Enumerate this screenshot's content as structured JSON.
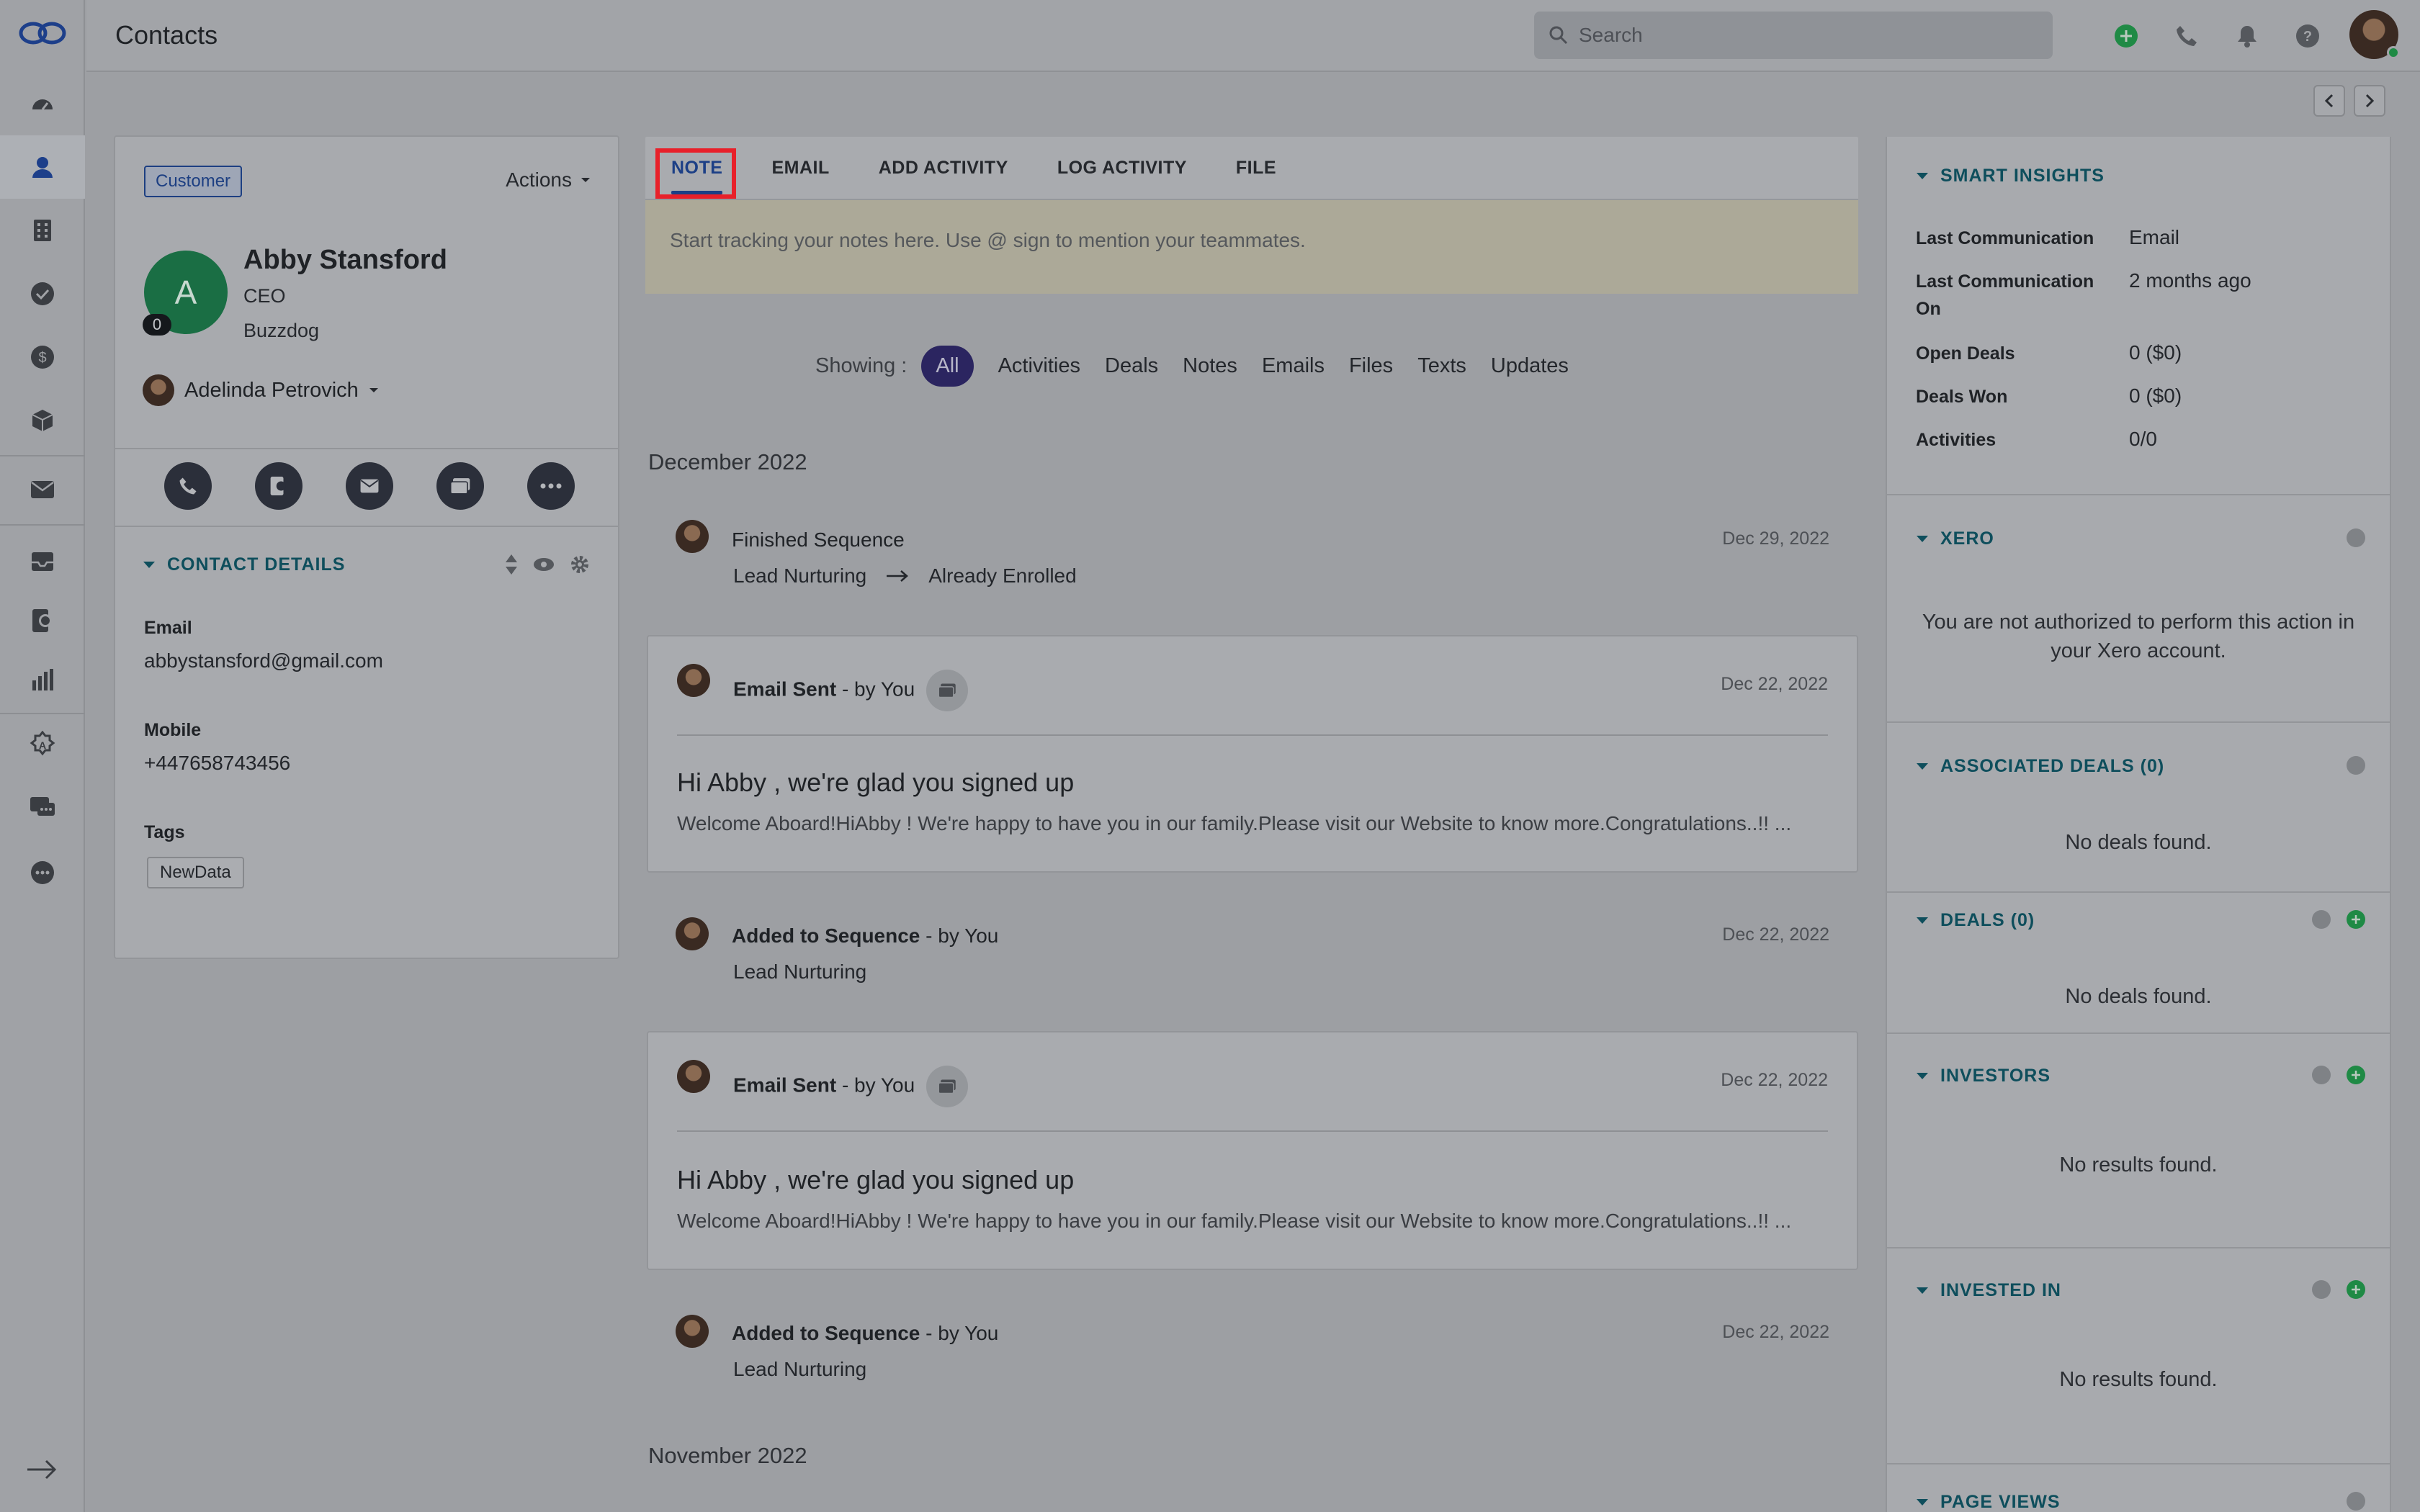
{
  "app": {
    "title": "Contacts"
  },
  "search": {
    "placeholder": "Search"
  },
  "contact": {
    "badge": "Customer",
    "actions_label": "Actions",
    "avatar_initial": "A",
    "avatar_count": "0",
    "name": "Abby Stansford",
    "role": "CEO",
    "company": "Buzzdog",
    "owner": "Adelinda Petrovich",
    "section_title": "CONTACT DETAILS",
    "fields": [
      {
        "label": "Email",
        "value": "abbystansford@gmail.com"
      },
      {
        "label": "Mobile",
        "value": "+447658743456"
      },
      {
        "label": "Tags",
        "value": ""
      }
    ],
    "tag": "NewData"
  },
  "composer": {
    "tabs": [
      "NOTE",
      "EMAIL",
      "ADD ACTIVITY",
      "LOG ACTIVITY",
      "FILE"
    ],
    "placeholder": "Start tracking your notes here. Use @ sign to mention your teammates."
  },
  "filters": {
    "label": "Showing :",
    "items": [
      "All",
      "Activities",
      "Deals",
      "Notes",
      "Emails",
      "Files",
      "Texts",
      "Updates"
    ]
  },
  "timeline": {
    "months": [
      "December 2022",
      "November 2022"
    ],
    "items": [
      {
        "title": "Finished Sequence",
        "by": "",
        "date": "Dec 29, 2022",
        "from": "Lead Nurturing",
        "to": "Already Enrolled"
      },
      {
        "title": "Email Sent",
        "by": " - by You",
        "date": "Dec 22, 2022",
        "subject": "Hi Abby , we're glad you signed up",
        "preview": "Welcome Aboard!HiAbby ! We're happy to have you in our family.Please visit our Website to know more.Congratulations..!! ..."
      },
      {
        "title": "Added to Sequence",
        "by": " - by You",
        "date": "Dec 22, 2022",
        "sub": "Lead Nurturing"
      },
      {
        "title": "Email Sent",
        "by": " - by You",
        "date": "Dec 22, 2022",
        "subject": "Hi Abby , we're glad you signed up",
        "preview": "Welcome Aboard!HiAbby ! We're happy to have you in our family.Please visit our Website to know more.Congratulations..!! ..."
      },
      {
        "title": "Added to Sequence",
        "by": " - by You",
        "date": "Dec 22, 2022",
        "sub": "Lead Nurturing"
      }
    ]
  },
  "insights": {
    "title": "SMART INSIGHTS",
    "rows": [
      {
        "key": "Last Communication",
        "value": "Email"
      },
      {
        "key": "Last Communication On",
        "value": "2 months ago"
      },
      {
        "key": "Open Deals",
        "value": "0 ($0)"
      },
      {
        "key": "Deals Won",
        "value": "0 ($0)"
      },
      {
        "key": "Activities",
        "value": "0/0"
      }
    ]
  },
  "right_sections": {
    "xero": {
      "title": "XERO",
      "message": "You are not authorized to perform this action in your Xero account."
    },
    "assoc_deals": {
      "title": "ASSOCIATED DEALS (0)",
      "message": "No deals found."
    },
    "deals": {
      "title": "DEALS (0)",
      "message": "No deals found."
    },
    "investors": {
      "title": "INVESTORS",
      "message": "No results found."
    },
    "invested_in": {
      "title": "INVESTED IN",
      "message": "No results found."
    },
    "page_views": {
      "title": "PAGE VIEWS"
    }
  },
  "colors": {
    "accent": "#1c3f86",
    "teal": "#0e4e5c",
    "green": "#1f8a45",
    "highlight": "#e8202a"
  }
}
